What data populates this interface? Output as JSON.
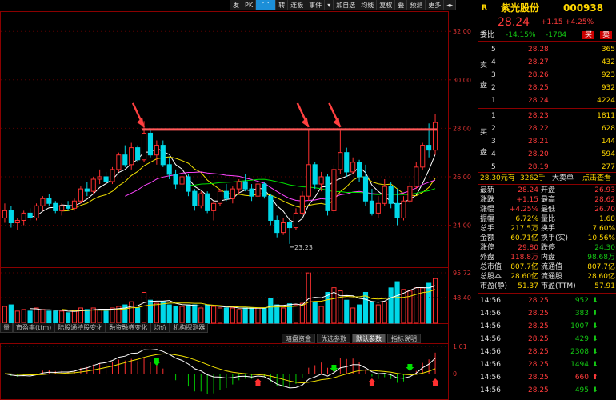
{
  "toolbar": {
    "items": [
      "发",
      "PK",
      "",
      "转",
      "连板",
      "事件",
      "▾",
      "加自选",
      "均线",
      "复权",
      "叠",
      "预测",
      "更多",
      "◂▸"
    ],
    "selected_index": 2
  },
  "chart_data": {
    "type": "candlestick",
    "price_axis": {
      "labels": [
        "32.00",
        "30.00",
        "28.00",
        "26.00",
        "24.00"
      ],
      "values": [
        32,
        30,
        28,
        26,
        24
      ]
    },
    "volume_axis": {
      "labels": [
        "95.72",
        "48.40"
      ]
    },
    "indicator_axis": {
      "labels": [
        "1.01",
        "0"
      ]
    },
    "low_annotation": "23.23",
    "resistance_level": 27.95,
    "candles": [
      [
        24.3,
        24.9,
        24.1,
        24.6
      ],
      [
        24.6,
        24.8,
        23.9,
        24.1
      ],
      [
        24.1,
        24.3,
        23.8,
        24.2
      ],
      [
        24.2,
        24.6,
        24.0,
        24.5
      ],
      [
        24.5,
        24.7,
        24.2,
        24.3
      ],
      [
        24.3,
        24.9,
        24.2,
        24.8
      ],
      [
        24.8,
        25.2,
        24.6,
        25.1
      ],
      [
        25.1,
        25.3,
        24.8,
        24.9
      ],
      [
        24.9,
        25.0,
        24.5,
        24.6
      ],
      [
        24.6,
        24.9,
        24.4,
        24.8
      ],
      [
        24.8,
        25.0,
        24.6,
        24.7
      ],
      [
        24.7,
        25.1,
        24.6,
        25.0
      ],
      [
        25.0,
        25.6,
        24.9,
        25.5
      ],
      [
        25.5,
        25.8,
        25.2,
        25.4
      ],
      [
        25.4,
        26.0,
        25.3,
        25.9
      ],
      [
        25.9,
        26.3,
        25.7,
        26.0
      ],
      [
        26.0,
        26.2,
        25.7,
        25.8
      ],
      [
        25.8,
        26.4,
        25.7,
        26.3
      ],
      [
        26.3,
        27.0,
        26.2,
        26.9
      ],
      [
        26.9,
        27.3,
        26.4,
        26.5
      ],
      [
        26.5,
        27.4,
        26.3,
        27.2
      ],
      [
        27.2,
        27.3,
        26.6,
        26.7
      ],
      [
        26.7,
        28.3,
        26.6,
        27.8
      ],
      [
        27.8,
        28.0,
        26.8,
        26.9
      ],
      [
        26.9,
        27.5,
        26.5,
        27.3
      ],
      [
        27.3,
        27.5,
        26.4,
        26.5
      ],
      [
        26.5,
        26.8,
        25.9,
        26.1
      ],
      [
        26.1,
        26.3,
        25.5,
        25.7
      ],
      [
        25.7,
        26.2,
        25.4,
        26.0
      ],
      [
        26.0,
        26.1,
        25.2,
        25.4
      ],
      [
        25.4,
        25.5,
        24.6,
        24.8
      ],
      [
        24.8,
        25.4,
        24.7,
        25.3
      ],
      [
        25.3,
        25.4,
        24.5,
        24.6
      ],
      [
        24.6,
        25.0,
        24.2,
        24.9
      ],
      [
        24.9,
        25.5,
        24.8,
        25.4
      ],
      [
        25.4,
        25.7,
        25.0,
        25.1
      ],
      [
        25.1,
        25.6,
        24.9,
        25.5
      ],
      [
        25.5,
        25.9,
        25.3,
        25.8
      ],
      [
        25.8,
        26.1,
        25.4,
        25.5
      ],
      [
        25.5,
        25.7,
        25.0,
        25.2
      ],
      [
        25.2,
        25.8,
        25.1,
        25.7
      ],
      [
        25.7,
        25.8,
        25.1,
        25.2
      ],
      [
        25.2,
        25.3,
        24.0,
        24.2
      ],
      [
        24.2,
        24.4,
        23.5,
        23.7
      ],
      [
        23.7,
        24.3,
        23.6,
        24.1
      ],
      [
        24.1,
        24.2,
        23.23,
        23.9
      ],
      [
        23.9,
        24.7,
        23.8,
        24.5
      ],
      [
        24.5,
        25.4,
        24.4,
        25.2
      ],
      [
        25.2,
        27.95,
        25.0,
        26.5
      ],
      [
        26.5,
        26.6,
        25.5,
        25.7
      ],
      [
        25.7,
        26.2,
        25.4,
        26.0
      ],
      [
        26.0,
        26.1,
        24.4,
        24.6
      ],
      [
        24.6,
        26.5,
        24.5,
        26.3
      ],
      [
        26.3,
        27.9,
        26.1,
        27.0
      ],
      [
        27.0,
        27.2,
        26.0,
        26.2
      ],
      [
        26.2,
        26.8,
        26.1,
        26.6
      ],
      [
        26.6,
        26.7,
        25.8,
        26.0
      ],
      [
        26.0,
        26.5,
        24.8,
        25.0
      ],
      [
        25.0,
        25.5,
        24.4,
        24.5
      ],
      [
        24.5,
        25.2,
        24.3,
        24.9
      ],
      [
        24.9,
        25.9,
        24.8,
        25.6
      ],
      [
        25.6,
        25.8,
        24.7,
        24.9
      ],
      [
        24.9,
        25.5,
        24.0,
        24.3
      ],
      [
        24.3,
        25.2,
        24.2,
        25.0
      ],
      [
        25.0,
        25.8,
        24.9,
        25.6
      ],
      [
        25.6,
        26.6,
        25.5,
        26.4
      ],
      [
        26.4,
        27.4,
        26.3,
        27.3
      ],
      [
        27.3,
        28.2,
        26.8,
        27.1
      ],
      [
        27.1,
        28.6,
        26.9,
        28.24
      ]
    ]
  },
  "indicator_tabs_left": [
    "量",
    "市盈率(ttm)",
    "陆股通持股变化",
    "融资融券变化",
    "均价",
    "机构探测器"
  ],
  "indicator_tabs_right": [
    {
      "label": "暗盘资金",
      "active": false
    },
    {
      "label": "优选参数",
      "active": false
    },
    {
      "label": "默认参数",
      "active": true
    },
    {
      "label": "指标说明",
      "active": false
    }
  ],
  "quote": {
    "letter": "R",
    "name": "紫光股份",
    "code": "000938",
    "price": "28.24",
    "change": "+1.15",
    "change_pct": "+4.25%",
    "weibi_label": "委比",
    "weibi_pct": "-14.15%",
    "weibi_diff": "-1784",
    "buy_btn": "买",
    "sell_btn": "卖",
    "sell_label": [
      "卖",
      "盘"
    ],
    "buy_label": [
      "买",
      "盘"
    ],
    "asks": [
      {
        "lvl": "5",
        "price": "28.28",
        "vol": "365"
      },
      {
        "lvl": "4",
        "price": "28.27",
        "vol": "432"
      },
      {
        "lvl": "3",
        "price": "28.26",
        "vol": "923"
      },
      {
        "lvl": "2",
        "price": "28.25",
        "vol": "932"
      },
      {
        "lvl": "1",
        "price": "28.24",
        "vol": "4224"
      }
    ],
    "bids": [
      {
        "lvl": "1",
        "price": "28.23",
        "vol": "1811"
      },
      {
        "lvl": "2",
        "price": "28.22",
        "vol": "628"
      },
      {
        "lvl": "3",
        "price": "28.21",
        "vol": "144"
      },
      {
        "lvl": "4",
        "price": "28.20",
        "vol": "594"
      },
      {
        "lvl": "5",
        "price": "28.19",
        "vol": "277"
      }
    ],
    "bigorder": {
      "amount": "28.30元有",
      "hands": "3262手",
      "type": "大卖单",
      "link": "点击查看"
    },
    "stats": [
      [
        "最新",
        "28.24",
        "开盘",
        "26.93"
      ],
      [
        "涨跌",
        "+1.15",
        "最高",
        "28.62"
      ],
      [
        "涨幅",
        "+4.25%",
        "最低",
        "26.70"
      ],
      [
        "振幅",
        "6.72%",
        "量比",
        "1.68"
      ],
      [
        "总手",
        "217.5万",
        "换手",
        "7.60%"
      ],
      [
        "金额",
        "60.71亿",
        "换手(实)",
        "10.56%"
      ],
      [
        "涨停",
        "29.80",
        "跌停",
        "24.30"
      ],
      [
        "外盘",
        "118.8万",
        "内盘",
        "98.68万"
      ],
      [
        "总市值",
        "807.7亿",
        "流通值",
        "807.7亿"
      ],
      [
        "总股本",
        "28.60亿",
        "流通股",
        "28.60亿"
      ],
      [
        "市盈(静)",
        "51.37",
        "市盈(TTM)",
        "57.91"
      ]
    ],
    "ticks": [
      {
        "time": "14:56",
        "price": "28.25",
        "vol": "952",
        "dir": "down"
      },
      {
        "time": "14:56",
        "price": "28.25",
        "vol": "383",
        "dir": "down"
      },
      {
        "time": "14:56",
        "price": "28.25",
        "vol": "1007",
        "dir": "down"
      },
      {
        "time": "14:56",
        "price": "28.25",
        "vol": "429",
        "dir": "down"
      },
      {
        "time": "14:56",
        "price": "28.25",
        "vol": "2308",
        "dir": "down"
      },
      {
        "time": "14:56",
        "price": "28.25",
        "vol": "1494",
        "dir": "down"
      },
      {
        "time": "14:56",
        "price": "28.25",
        "vol": "660",
        "dir": "up"
      },
      {
        "time": "14:56",
        "price": "28.25",
        "vol": "495",
        "dir": "down"
      }
    ]
  }
}
